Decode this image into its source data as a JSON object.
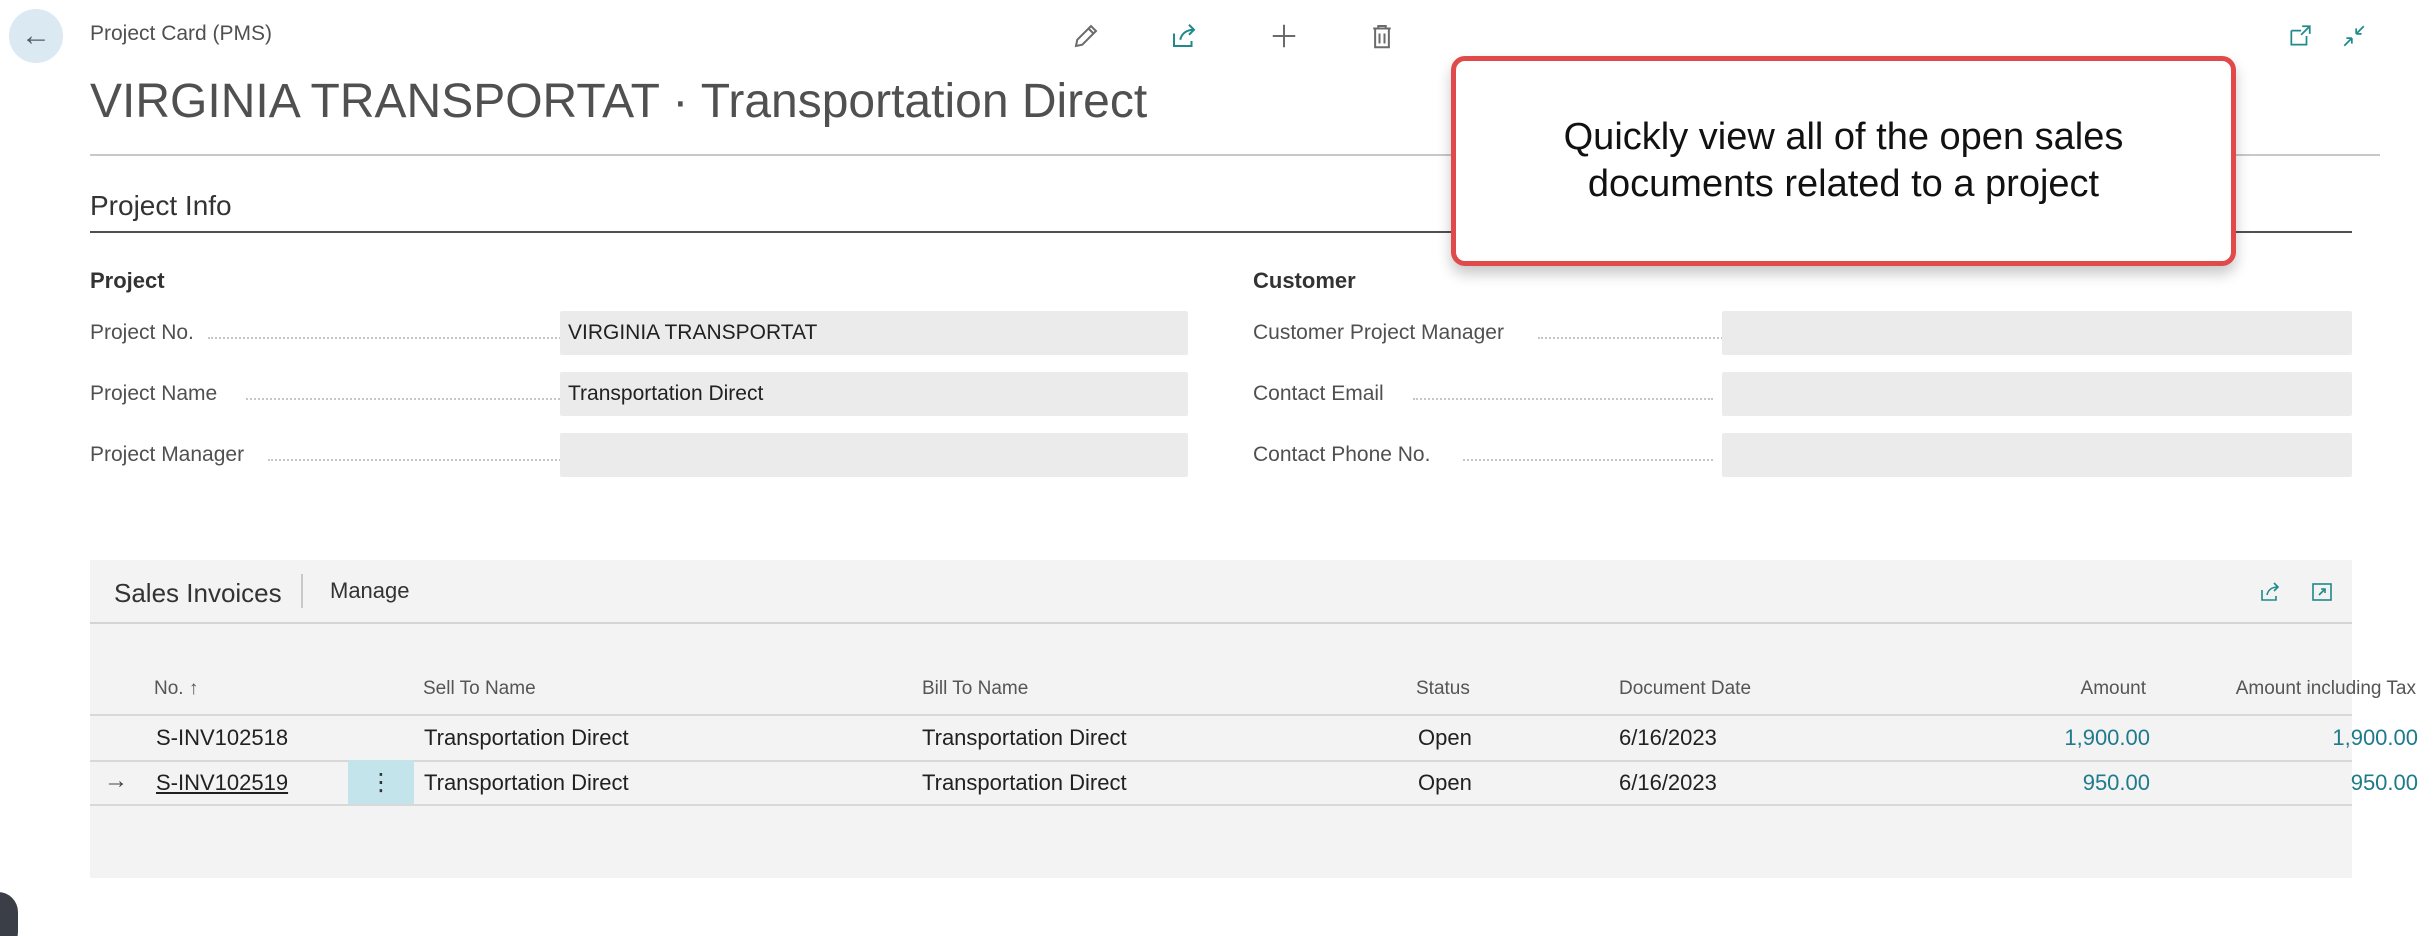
{
  "header": {
    "breadcrumb": "Project Card (PMS)",
    "title": "VIRGINIA TRANSPORTAT · Transportation Direct"
  },
  "toolbar": {
    "icons": [
      "edit-icon",
      "share-icon",
      "new-icon",
      "delete-icon"
    ],
    "right_icons": [
      "open-new-window-icon",
      "collapse-icon"
    ]
  },
  "callout": {
    "text": "Quickly view all of the open sales documents related to a project",
    "border_color": "#e04a4a"
  },
  "project_info": {
    "section_title": "Project Info",
    "project_group": {
      "heading": "Project",
      "fields": [
        {
          "label": "Project No.",
          "value": "VIRGINIA TRANSPORTAT"
        },
        {
          "label": "Project Name",
          "value": "Transportation Direct"
        },
        {
          "label": "Project Manager",
          "value": ""
        }
      ]
    },
    "customer_group": {
      "heading": "Customer",
      "fields": [
        {
          "label": "Customer Project Manager",
          "value": ""
        },
        {
          "label": "Contact Email",
          "value": ""
        },
        {
          "label": "Contact Phone No.",
          "value": ""
        }
      ]
    }
  },
  "sales_invoices": {
    "caption": "Sales Invoices",
    "manage_label": "Manage",
    "columns": {
      "no": "No. ↑",
      "sell_to_name": "Sell To Name",
      "bill_to_name": "Bill To Name",
      "status": "Status",
      "document_date": "Document Date",
      "amount": "Amount",
      "amount_incl_tax": "Amount including Tax"
    },
    "rows": [
      {
        "no": "S-INV102518",
        "sell_to_name": "Transportation Direct",
        "bill_to_name": "Transportation Direct",
        "status": "Open",
        "document_date": "6/16/2023",
        "amount": "1,900.00",
        "amount_incl_tax": "1,900.00"
      },
      {
        "no": "S-INV102519",
        "sell_to_name": "Transportation Direct",
        "bill_to_name": "Transportation Direct",
        "status": "Open",
        "document_date": "6/16/2023",
        "amount": "950.00",
        "amount_incl_tax": "950.00"
      }
    ],
    "selected_row_arrow": "→",
    "row_menu_glyph": "⋮"
  },
  "colors": {
    "accent": "#1f8a8a",
    "amount_text": "#1f7a8c",
    "selected_menu_bg": "#c3e4ea"
  }
}
